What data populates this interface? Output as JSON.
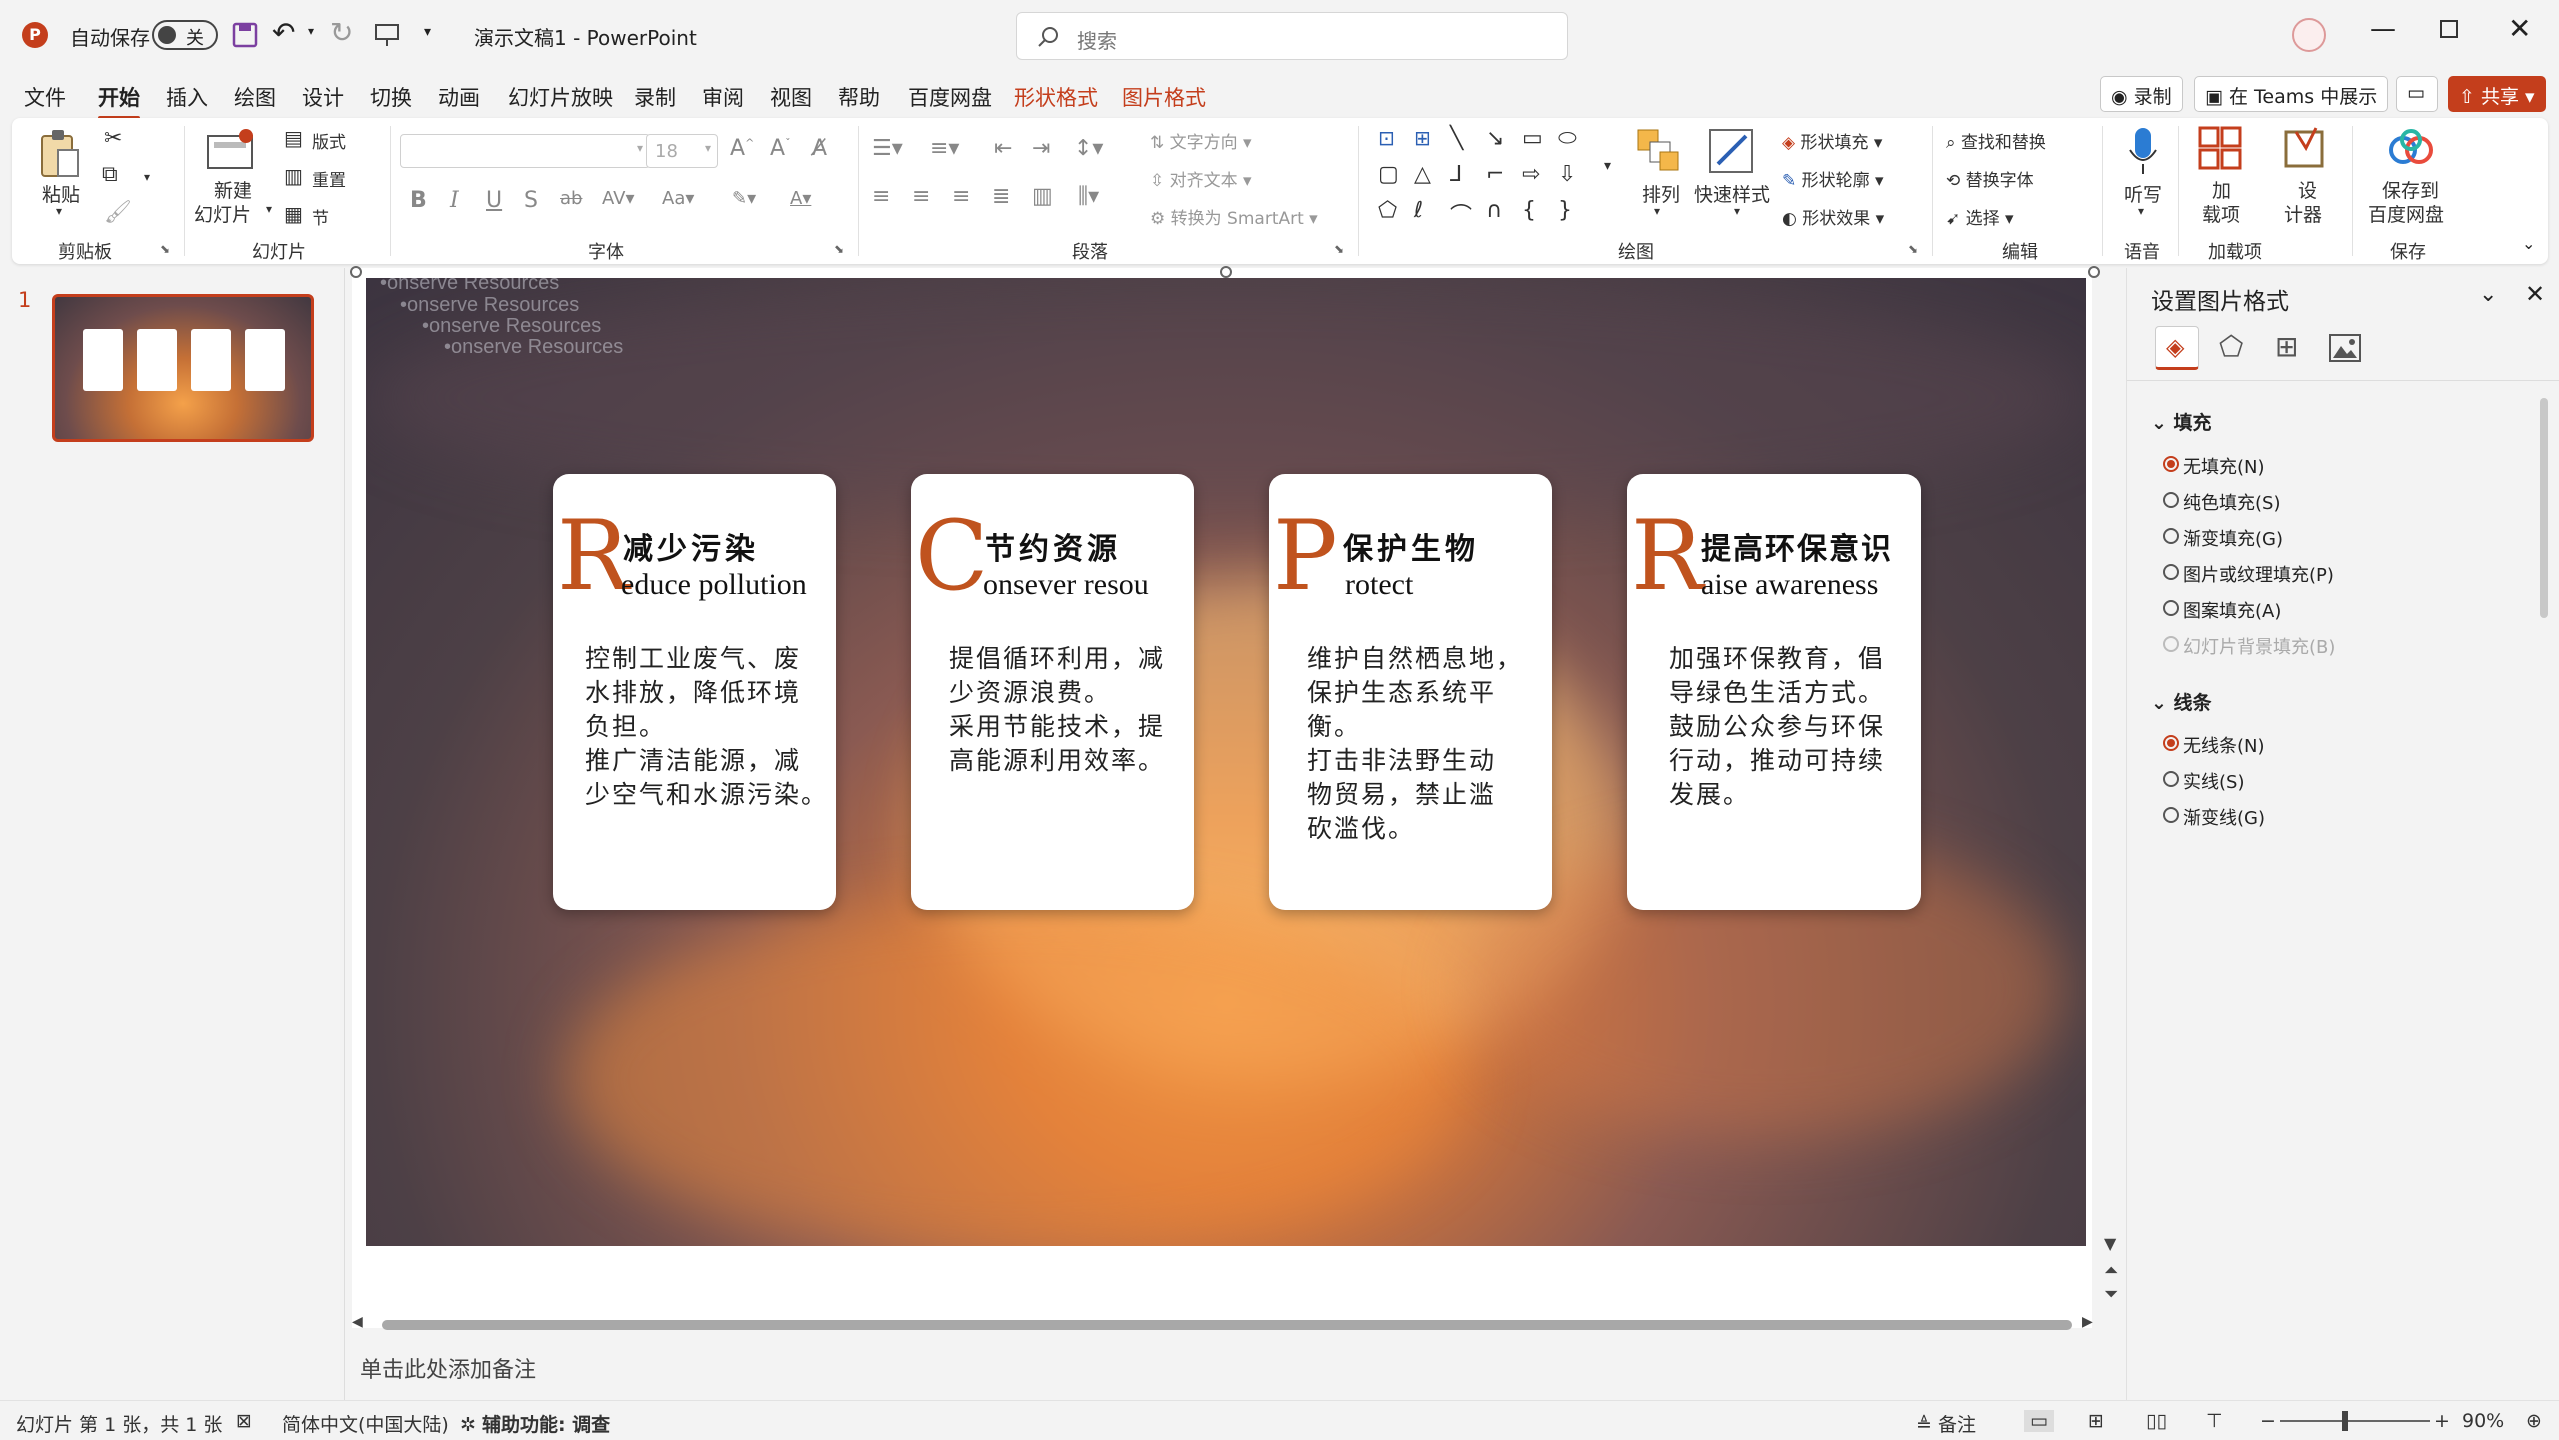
{
  "title_bar": {
    "autosave_label": "自动保存",
    "autosave_state": "关",
    "doc_title": "演示文稿1  -  PowerPoint",
    "search_placeholder": "搜索"
  },
  "menu": {
    "tabs": [
      "文件",
      "开始",
      "插入",
      "绘图",
      "设计",
      "切换",
      "动画",
      "幻灯片放映",
      "录制",
      "审阅",
      "视图",
      "帮助",
      "百度网盘",
      "形状格式",
      "图片格式"
    ],
    "active": "开始",
    "record_label": "录制",
    "teams_label": "在 Teams 中展示",
    "share_label": "共享"
  },
  "ribbon": {
    "clipboard": {
      "paste": "粘贴",
      "group": "剪贴板"
    },
    "slides": {
      "new_slide_1": "新建",
      "new_slide_2": "幻灯片",
      "layout": "版式",
      "reset": "重置",
      "section": "节",
      "group": "幻灯片"
    },
    "font": {
      "size": "18",
      "group": "字体"
    },
    "paragraph": {
      "text_direction": "文字方向",
      "align_text": "对齐文本",
      "smartart": "转换为 SmartArt",
      "group": "段落"
    },
    "drawing": {
      "arrange": "排列",
      "quick_styles": "快速样式",
      "shape_fill": "形状填充",
      "shape_outline": "形状轮廓",
      "shape_effects": "形状效果",
      "group": "绘图"
    },
    "editing": {
      "find_replace": "查找和替换",
      "replace_font": "替换字体",
      "select": "选择",
      "group": "编辑"
    },
    "voice": {
      "dictate": "听写",
      "group": "语音"
    },
    "addins": {
      "addin_1": "加",
      "addin_2": "载项",
      "group": "加载项"
    },
    "designer": {
      "d1": "设",
      "d2": "计器"
    },
    "save": {
      "s1": "保存到",
      "s2": "百度网盘",
      "group": "保存"
    }
  },
  "thumbnail": {
    "number": "1"
  },
  "slide": {
    "ghost_lines": [
      "•onserve Resources",
      "•onserve Resources",
      "•onserve Resources",
      "•onserve Resources"
    ],
    "cards": [
      {
        "letter": "R",
        "zh": "减少污染",
        "en": "educe pollution",
        "body": "控制工业废气、废\n水排放，降低环境\n负担。\n推广清洁能源，减\n少空气和水源污染。"
      },
      {
        "letter": "C",
        "zh": "节约资源",
        "en": "onsever resou",
        "body": "提倡循环利用，减\n少资源浪费。\n采用节能技术，提\n高能源利用效率。"
      },
      {
        "letter": "P",
        "zh": "保护生物",
        "en": "rotect",
        "body": "维护自然栖息地，\n保护生态系统平\n衡。\n打击非法野生动\n物贸易，禁止滥\n砍滥伐。"
      },
      {
        "letter": "R",
        "zh": "提高环保意识",
        "en": "aise awareness",
        "body": "加强环保教育，倡\n导绿色生活方式。\n鼓励公众参与环保\n行动，推动可持续\n发展。"
      }
    ]
  },
  "notes": {
    "placeholder": "单击此处添加备注"
  },
  "format_pane": {
    "title": "设置图片格式",
    "fill_title": "填充",
    "fill_options": [
      "无填充(N)",
      "纯色填充(S)",
      "渐变填充(G)",
      "图片或纹理填充(P)",
      "图案填充(A)",
      "幻灯片背景填充(B)"
    ],
    "line_title": "线条",
    "line_options": [
      "无线条(N)",
      "实线(S)",
      "渐变线(G)"
    ]
  },
  "status": {
    "slide_info": "幻灯片 第 1 张，共 1 张",
    "language": "简体中文(中国大陆)",
    "accessibility": "辅助功能: 调查",
    "notes_btn": "备注",
    "zoom": "90%"
  },
  "colors": {
    "accent": "#c43e1c",
    "card_letter": "#c0531e"
  }
}
